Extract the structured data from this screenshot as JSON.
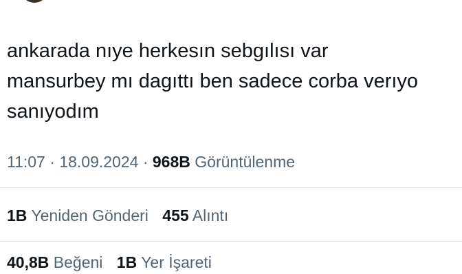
{
  "tweet": {
    "text": "ankarada nıye herkesın sebgılısı var\nmansurbey mı dagıttı ben sadece corba verıyo\nsanıyodım"
  },
  "meta": {
    "time": "11:07",
    "date": "18.09.2024",
    "separator": "·",
    "views_count": "968B",
    "views_label": "Görüntülenme"
  },
  "stats_row1": {
    "reposts_count": "1B",
    "reposts_label": "Yeniden Gönderi",
    "quotes_count": "455",
    "quotes_label": "Alıntı"
  },
  "stats_row2": {
    "likes_count": "40,8B",
    "likes_label": "Beğeni",
    "bookmarks_count": "1B",
    "bookmarks_label": "Yer İşareti"
  },
  "colors": {
    "text_primary": "#0f1419",
    "text_secondary": "#536471",
    "divider": "#dfe3e6"
  }
}
